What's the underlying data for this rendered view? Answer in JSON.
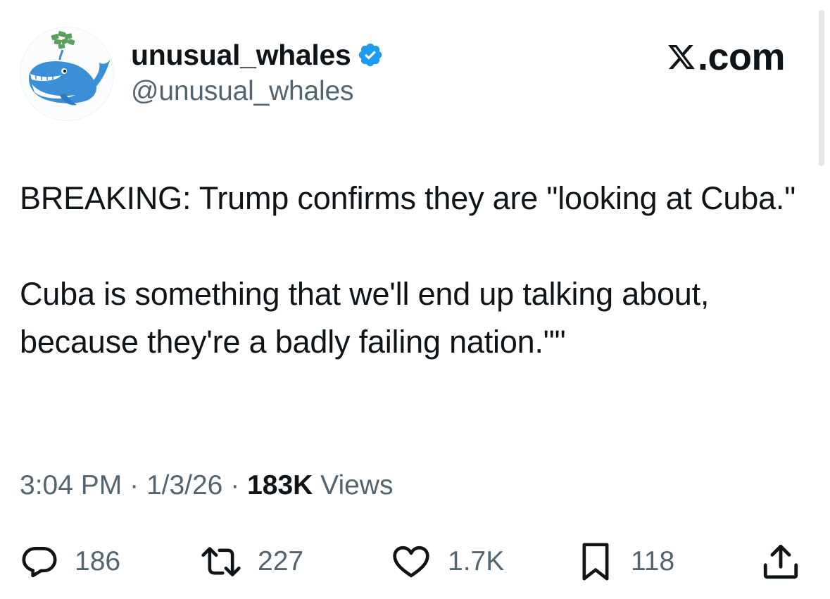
{
  "account": {
    "display_name": "unusual_whales",
    "handle": "@unusual_whales",
    "verified": true,
    "avatar_icon": "whale-icon"
  },
  "brand": {
    "label": ".com",
    "logo_icon": "x-logo-icon"
  },
  "tweet": {
    "paragraphs": [
      "BREAKING: Trump confirms they are \"looking at Cuba.\"",
      "Cuba is something that we'll end up talking about, because they're a badly failing nation.\"\""
    ],
    "time": "3:04 PM",
    "date": "1/3/26",
    "separator": "·",
    "views_count": "183K",
    "views_label": "Views"
  },
  "actions": {
    "replies": "186",
    "reposts": "227",
    "likes": "1.7K",
    "bookmarks": "118"
  },
  "colors": {
    "text": "#0f1419",
    "secondary": "#536471",
    "verified_badge": "#1d9bf0",
    "whale_blue": "#3a8fd6",
    "background": "#ffffff"
  }
}
